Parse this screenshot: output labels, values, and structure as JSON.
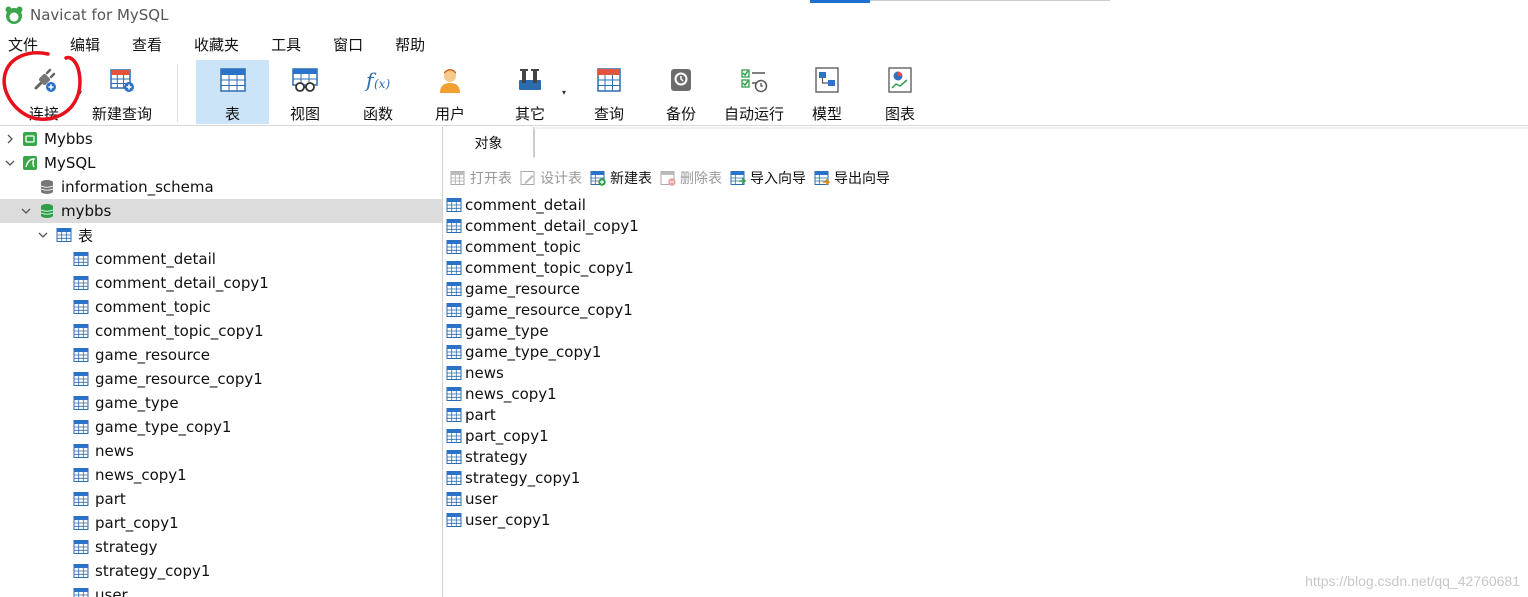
{
  "window": {
    "title": "Navicat for MySQL"
  },
  "menu": [
    "文件",
    "编辑",
    "查看",
    "收藏夹",
    "工具",
    "窗口",
    "帮助"
  ],
  "toolbar": {
    "connect": "连接",
    "new_query": "新建查询",
    "table": "表",
    "view": "视图",
    "function": "函数",
    "user": "用户",
    "other": "其它",
    "query": "查询",
    "backup": "备份",
    "automation": "自动运行",
    "model": "模型",
    "chart": "图表"
  },
  "tree": {
    "connections": [
      {
        "name": "Mybbs",
        "expanded": false
      },
      {
        "name": "MySQL",
        "expanded": true
      }
    ],
    "databases": [
      "information_schema",
      "mybbs"
    ],
    "selected_db": "mybbs",
    "tables_node": "表",
    "tables": [
      "comment_detail",
      "comment_detail_copy1",
      "comment_topic",
      "comment_topic_copy1",
      "game_resource",
      "game_resource_copy1",
      "game_type",
      "game_type_copy1",
      "news",
      "news_copy1",
      "part",
      "part_copy1",
      "strategy",
      "strategy_copy1",
      "user"
    ]
  },
  "objects_tab": "对象",
  "object_toolbar": {
    "open": "打开表",
    "design": "设计表",
    "new": "新建表",
    "delete": "删除表",
    "import": "导入向导",
    "export": "导出向导"
  },
  "object_list": [
    "comment_detail",
    "comment_detail_copy1",
    "comment_topic",
    "comment_topic_copy1",
    "game_resource",
    "game_resource_copy1",
    "game_type",
    "game_type_copy1",
    "news",
    "news_copy1",
    "part",
    "part_copy1",
    "strategy",
    "strategy_copy1",
    "user",
    "user_copy1"
  ],
  "watermark": "https://blog.csdn.net/qq_42760681",
  "colors": {
    "accent": "#cce4f7",
    "selected_row": "#dcdcdc",
    "annotation": "#e8101a"
  }
}
